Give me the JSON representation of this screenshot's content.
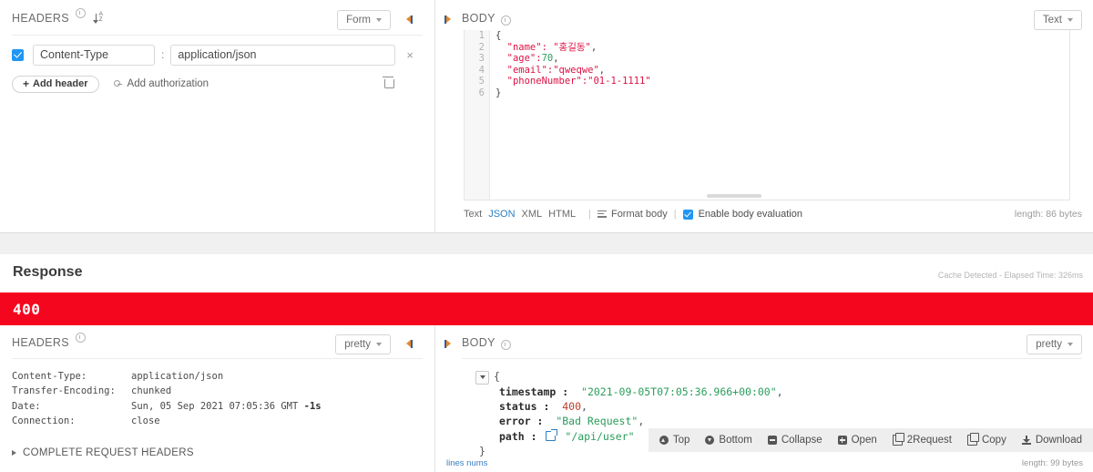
{
  "request": {
    "headers_panel": {
      "title": "HEADERS",
      "mode_label": "Form",
      "sort_icon": "sort-az-icon",
      "info_icon": "info-icon",
      "rows": [
        {
          "enabled": true,
          "key": "Content-Type",
          "separator": ":",
          "value": "application/json",
          "remove_label": "×"
        }
      ],
      "add_header_label": "Add header",
      "add_header_plus": "+",
      "add_authorization_label": "Add authorization",
      "delete_all_icon": "trash-icon"
    },
    "body_panel": {
      "title": "BODY",
      "mode_label": "Text",
      "line_numbers": [
        "1",
        "2",
        "3",
        "4",
        "5",
        "6"
      ],
      "code_lines": [
        {
          "parts": [
            {
              "t": "{",
              "c": "p"
            }
          ]
        },
        {
          "parts": [
            {
              "t": "  \"name\": ",
              "c": "k"
            },
            {
              "t": "\"홍길동\"",
              "c": "s"
            },
            {
              "t": ",",
              "c": "p"
            }
          ]
        },
        {
          "parts": [
            {
              "t": "  \"age\":",
              "c": "k"
            },
            {
              "t": "70",
              "c": "n"
            },
            {
              "t": ",",
              "c": "p"
            }
          ]
        },
        {
          "parts": [
            {
              "t": "  \"email\":",
              "c": "k"
            },
            {
              "t": "\"qweqwe\"",
              "c": "s"
            },
            {
              "t": ",",
              "c": "p"
            }
          ]
        },
        {
          "parts": [
            {
              "t": "  \"phoneNumber\":",
              "c": "k"
            },
            {
              "t": "\"01-1-1111\"",
              "c": "s"
            }
          ]
        },
        {
          "parts": [
            {
              "t": "}",
              "c": "p"
            }
          ]
        }
      ],
      "toolbar": {
        "formats": [
          "Text",
          "JSON",
          "XML",
          "HTML"
        ],
        "active_format": "JSON",
        "format_body_label": "Format body",
        "enable_eval_label": "Enable body evaluation",
        "enable_eval_checked": true,
        "length_label": "length: 86 bytes",
        "clear_icon": "trash-icon"
      }
    }
  },
  "response": {
    "title": "Response",
    "cache_note": "Cache Detected - Elapsed Time: 326ms",
    "status_code": "400",
    "status_color": "#f5061f",
    "headers_panel": {
      "title": "HEADERS",
      "mode_label": "pretty",
      "rows": [
        {
          "key": "Content-Type:",
          "value": "application/json",
          "bold_suffix": ""
        },
        {
          "key": "Transfer-Encoding:",
          "value": "chunked",
          "bold_suffix": ""
        },
        {
          "key": "Date:",
          "value": "Sun, 05 Sep 2021 07:05:36 GMT ",
          "bold_suffix": "-1s"
        },
        {
          "key": "Connection:",
          "value": "close",
          "bold_suffix": ""
        }
      ],
      "complete_request_headers_label": "COMPLETE REQUEST HEADERS"
    },
    "body_panel": {
      "title": "BODY",
      "mode_label": "pretty",
      "open_brace": "{",
      "close_brace": "}",
      "fields": [
        {
          "key": "timestamp :",
          "value": "\"2021-09-05T07:05:36.966+00:00\"",
          "type": "string",
          "comma": ",",
          "link": false
        },
        {
          "key": "status :",
          "value": "400",
          "type": "number",
          "comma": ",",
          "link": false
        },
        {
          "key": "error :",
          "value": "\"Bad Request\"",
          "type": "string",
          "comma": ",",
          "link": false
        },
        {
          "key": "path :",
          "value": "\"/api/user\"",
          "type": "string",
          "comma": "",
          "link": true
        }
      ],
      "lines_nums_label": "lines nums",
      "length_label": "length: 99 bytes",
      "actions": [
        {
          "label": "Top",
          "icon": "circle-up-icon"
        },
        {
          "label": "Bottom",
          "icon": "circle-down-icon"
        },
        {
          "label": "Collapse",
          "icon": "minus-square-icon"
        },
        {
          "label": "Open",
          "icon": "plus-square-icon"
        },
        {
          "label": "2Request",
          "icon": "copy-to-request-icon"
        },
        {
          "label": "Copy",
          "icon": "copy-icon"
        },
        {
          "label": "Download",
          "icon": "download-icon"
        }
      ]
    }
  }
}
